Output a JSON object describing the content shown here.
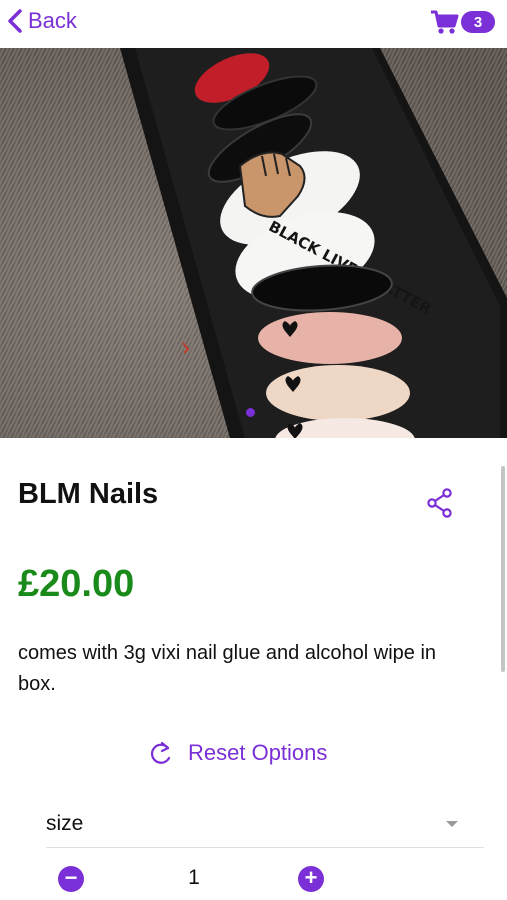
{
  "header": {
    "back_label": "Back",
    "cart_count": "3",
    "accent_color": "#7b2fd6"
  },
  "product": {
    "image": {
      "nail_lettering": "BLACK LIVES MATTER",
      "active_slide": 1
    },
    "title": "BLM Nails",
    "price": "£20.00",
    "price_color": "#1a8a1a",
    "description": "comes with 3g vixi nail glue and alcohol wipe in box."
  },
  "options": {
    "reset_label": "Reset Options",
    "size_label": "size"
  },
  "quantity": {
    "value": "1"
  },
  "icons": [
    "chevron-left-icon",
    "cart-icon",
    "share-icon",
    "refresh-icon",
    "caret-down-icon",
    "minus-icon",
    "plus-icon"
  ]
}
